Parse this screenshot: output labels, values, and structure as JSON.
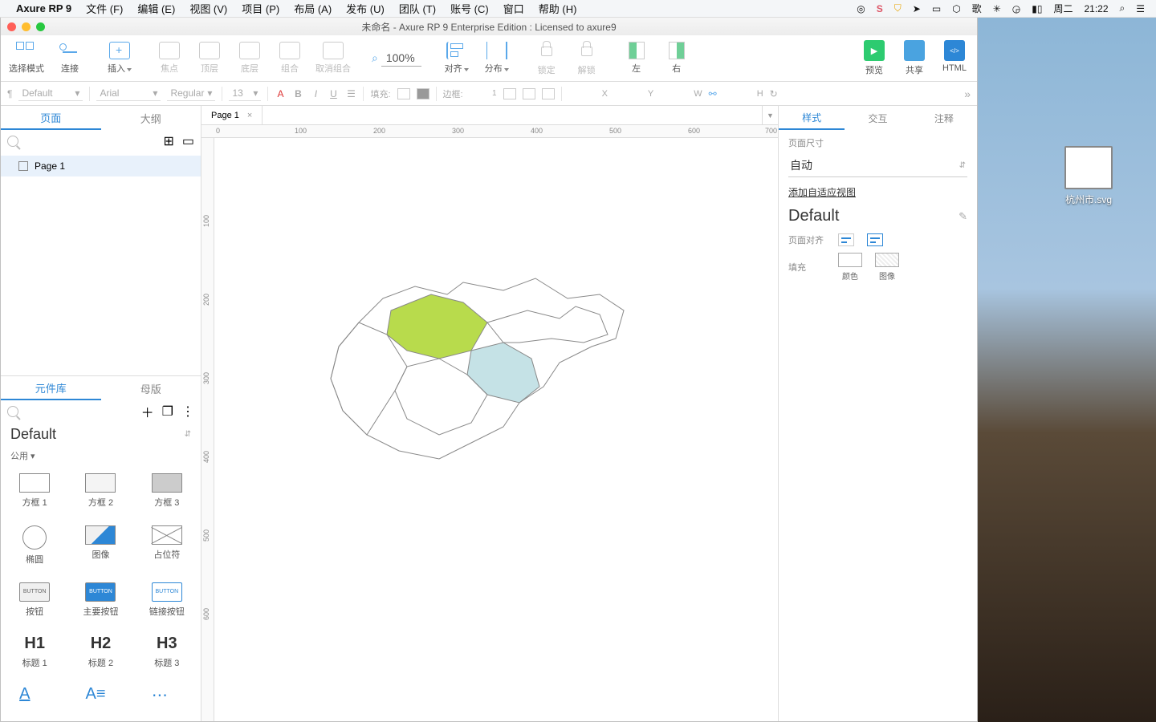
{
  "menubar": {
    "app": "Axure RP 9",
    "items": [
      "文件 (F)",
      "编辑 (E)",
      "视图 (V)",
      "项目 (P)",
      "布局 (A)",
      "发布 (U)",
      "团队 (T)",
      "账号 (C)",
      "窗口",
      "帮助 (H)"
    ],
    "tray": {
      "day": "周二",
      "time": "21:22"
    }
  },
  "window": {
    "title": "未命名 - Axure RP 9 Enterprise Edition : Licensed to axure9"
  },
  "toolbar": {
    "select_mode": "选择模式",
    "connect": "连接",
    "insert": "插入",
    "points": "焦点",
    "top": "顶层",
    "bottom": "底层",
    "group": "组合",
    "ungroup": "取消组合",
    "zoom_value": "100%",
    "align": "对齐",
    "distribute": "分布",
    "lock": "锁定",
    "unlock": "解锁",
    "left": "左",
    "right": "右",
    "preview": "预览",
    "share": "共享",
    "html": "HTML"
  },
  "propbar": {
    "style": "Default",
    "font": "Arial",
    "weight": "Regular",
    "size": "13",
    "fill_label": "填充:",
    "border_label": "边框:",
    "border_w": "1",
    "x": "X",
    "y": "Y",
    "w": "W",
    "h": "H"
  },
  "left": {
    "tabs": {
      "pages": "页面",
      "outline": "大纲"
    },
    "page1": "Page 1",
    "libs": {
      "tab_lib": "元件库",
      "tab_master": "母版",
      "lib_name": "Default",
      "cat": "公用 ▾",
      "items": [
        {
          "n": "方框 1"
        },
        {
          "n": "方框 2"
        },
        {
          "n": "方框 3"
        },
        {
          "n": "椭圆"
        },
        {
          "n": "图像"
        },
        {
          "n": "占位符"
        },
        {
          "n": "按钮",
          "b": "BUTTON"
        },
        {
          "n": "主要按钮",
          "b": "BUTTON"
        },
        {
          "n": "链接按钮",
          "b": "BUTTON"
        },
        {
          "n": "标题 1",
          "h": "H1"
        },
        {
          "n": "标题 2",
          "h": "H2"
        },
        {
          "n": "标题 3",
          "h": "H3"
        }
      ]
    }
  },
  "doctab": {
    "name": "Page 1"
  },
  "ruler_h": [
    "0",
    "100",
    "200",
    "300",
    "400",
    "500",
    "600",
    "700"
  ],
  "ruler_v": [
    "100",
    "200",
    "300",
    "400",
    "500",
    "600"
  ],
  "right": {
    "tabs": {
      "style": "样式",
      "interact": "交互",
      "notes": "注释"
    },
    "page_size_label": "页面尺寸",
    "page_size_value": "自动",
    "adaptive": "添加自适应视图",
    "default": "Default",
    "align_label": "页面对齐",
    "fill_label": "填充",
    "color": "颜色",
    "image": "图像"
  },
  "desktop_file": "杭州市.svg"
}
